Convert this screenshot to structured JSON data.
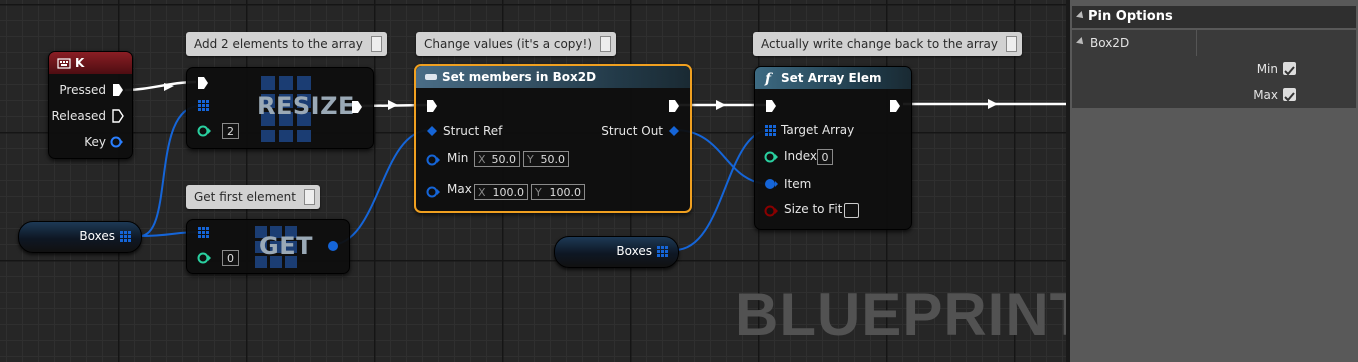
{
  "watermark": "BLUEPRINT",
  "comments": {
    "resize": "Add 2 elements to the array",
    "set_members": "Change values (it's a copy!)",
    "set_array_elem": "Actually write change back to the array",
    "get": "Get first element"
  },
  "key_node": {
    "title": "K",
    "pins": {
      "pressed": "Pressed",
      "released": "Released",
      "key": "Key"
    }
  },
  "resize_node": {
    "label": "RESIZE",
    "size_value": "2"
  },
  "get_node": {
    "label": "GET",
    "index_value": "0"
  },
  "boxes_var_1": {
    "label": "Boxes"
  },
  "boxes_var_2": {
    "label": "Boxes"
  },
  "set_members_node": {
    "title": "Set members in Box2D",
    "pins": {
      "struct_ref": "Struct Ref",
      "struct_out": "Struct Out",
      "min": "Min",
      "max": "Max"
    },
    "min": {
      "x_axis": "X",
      "x": "50.0",
      "y_axis": "Y",
      "y": "50.0"
    },
    "max": {
      "x_axis": "X",
      "x": "100.0",
      "y_axis": "Y",
      "y": "100.0"
    }
  },
  "set_array_elem_node": {
    "title": "Set Array Elem",
    "pins": {
      "target_array": "Target Array",
      "index": "Index",
      "index_value": "0",
      "item": "Item",
      "size_to_fit": "Size to Fit"
    },
    "size_to_fit_checked": false
  },
  "panel": {
    "title": "Pin Options",
    "section": "Box2D",
    "options": [
      {
        "label": "Min",
        "checked": true
      },
      {
        "label": "Max",
        "checked": true
      }
    ]
  },
  "colors": {
    "exec": "#ffffff",
    "struct": "#1565d8",
    "int": "#2ad0a0",
    "bool": "#8a0000",
    "key": "#2a7fff",
    "selection": "#f0a020",
    "panel_bg": "#595959"
  }
}
